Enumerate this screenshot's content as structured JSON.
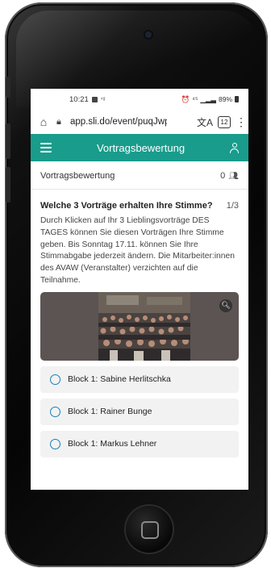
{
  "status": {
    "time": "10:21",
    "battery": "89%"
  },
  "browser": {
    "url": "app.sli.do/event/puqJwpvc",
    "tab_count": "12"
  },
  "appbar": {
    "title": "Vortragsbewertung"
  },
  "section": {
    "title": "Vortragsbewertung",
    "participant_count": "0"
  },
  "question": {
    "title": "Welche 3 Vorträge erhalten Ihre Stimme?",
    "step": "1/3",
    "description": "Durch Klicken auf Ihr 3 Lieblingsvorträge DES TAGES können Sie diesen Vorträgen Ihre Stimme geben. Bis Sonntag 17.11. können Sie Ihre Stimmabgabe jederzeit ändern. Die Mitarbeiter:innen des AVAW (Veranstalter) verzichten auf die Teilnahme."
  },
  "options": [
    {
      "label": "Block 1: Sabine Herlitschka"
    },
    {
      "label": "Block 1: Rainer Bunge"
    },
    {
      "label": "Block 1: Markus Lehner"
    }
  ],
  "colors": {
    "accent": "#199c8c",
    "radio": "#1a7fb8"
  }
}
